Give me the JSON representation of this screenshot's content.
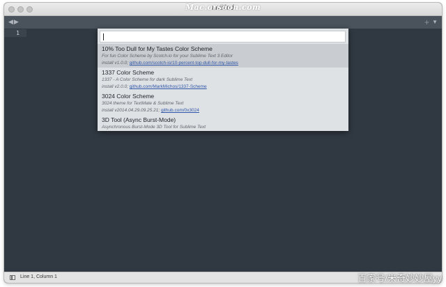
{
  "window": {
    "title": "untitled",
    "watermark": "Mac.orsoon.com"
  },
  "tabbar": {
    "nav_label": "◀▶",
    "plus_label": "+",
    "menu_label": "▼"
  },
  "editor": {
    "line_number": "1"
  },
  "palette": {
    "search_value": "",
    "items": [
      {
        "title": "10% Too Dull for My Tastes Color Scheme",
        "description": "For fun Color Scheme by Scotch.io for your Sublime Text 3 Editor",
        "install_prefix": "install v1.0.0;",
        "link": "github.com/scotch-io/10-percent-top-dull-for-my-tastes",
        "selected": true
      },
      {
        "title": "1337 Color Scheme",
        "description": "1337 - A Color Scheme for dark Sublime Text",
        "install_prefix": "install v2.0.0;",
        "link": "github.com/MarkMichos/1337-Scheme",
        "selected": false
      },
      {
        "title": "3024 Color Scheme",
        "description": "3024 theme for TextMate & Sublime Text",
        "install_prefix": "install v2014.04.29.09.25.21;",
        "link": "github.com/0x3024",
        "selected": false
      },
      {
        "title": "3D Tool (Async Burst-Mode)",
        "description": "Asynchronous Burst-Mode 3D Tool for Sublime Text",
        "selected": false
      }
    ]
  },
  "statusbar": {
    "position_text": "Line 1, Column 1"
  },
  "watermark_bottom": "百家号/米奇妙妙屋yy",
  "colors": {
    "editor_bg": "#303841",
    "palette_bg": "#dfe2e5",
    "selected_bg": "#c9ccd0",
    "link": "#2f56a8"
  }
}
